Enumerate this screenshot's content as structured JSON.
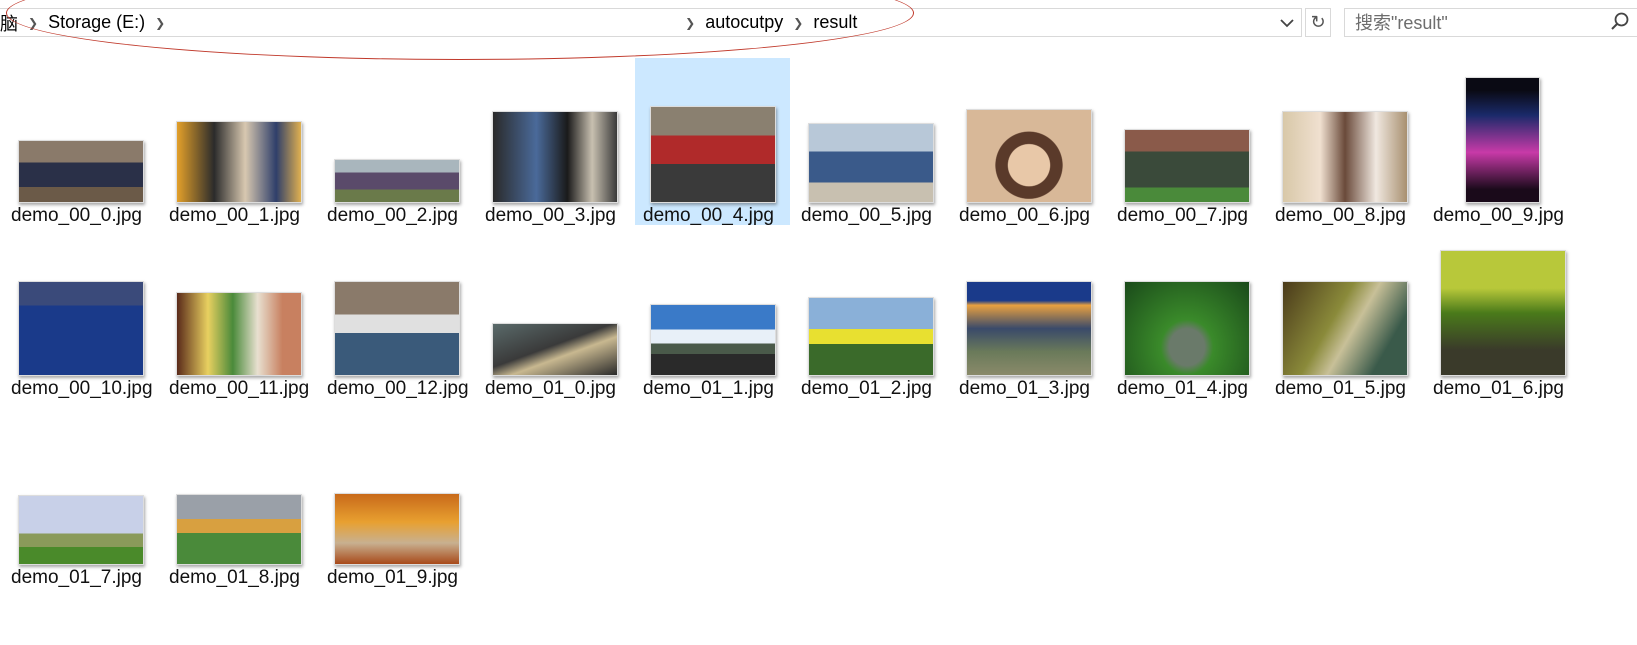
{
  "address": {
    "partial_prefix": "脑",
    "crumbs": [
      "Storage (E:)",
      "autocutpy",
      "result"
    ]
  },
  "search": {
    "placeholder": "搜索\"result\""
  },
  "files": [
    {
      "name": "demo_00_0.jpg"
    },
    {
      "name": "demo_00_1.jpg"
    },
    {
      "name": "demo_00_2.jpg"
    },
    {
      "name": "demo_00_3.jpg"
    },
    {
      "name": "demo_00_4.jpg",
      "selected": true
    },
    {
      "name": "demo_00_5.jpg"
    },
    {
      "name": "demo_00_6.jpg"
    },
    {
      "name": "demo_00_7.jpg"
    },
    {
      "name": "demo_00_8.jpg"
    },
    {
      "name": "demo_00_9.jpg"
    },
    {
      "name": "demo_00_10.jpg"
    },
    {
      "name": "demo_00_11.jpg"
    },
    {
      "name": "demo_00_12.jpg"
    },
    {
      "name": "demo_01_0.jpg"
    },
    {
      "name": "demo_01_1.jpg"
    },
    {
      "name": "demo_01_2.jpg"
    },
    {
      "name": "demo_01_3.jpg"
    },
    {
      "name": "demo_01_4.jpg"
    },
    {
      "name": "demo_01_5.jpg"
    },
    {
      "name": "demo_01_6.jpg"
    },
    {
      "name": "demo_01_7.jpg"
    },
    {
      "name": "demo_01_8.jpg"
    },
    {
      "name": "demo_01_9.jpg"
    }
  ],
  "colors": {
    "selection": "#cce8ff",
    "annotation": "#c0392b",
    "border": "#d9d9d9"
  }
}
